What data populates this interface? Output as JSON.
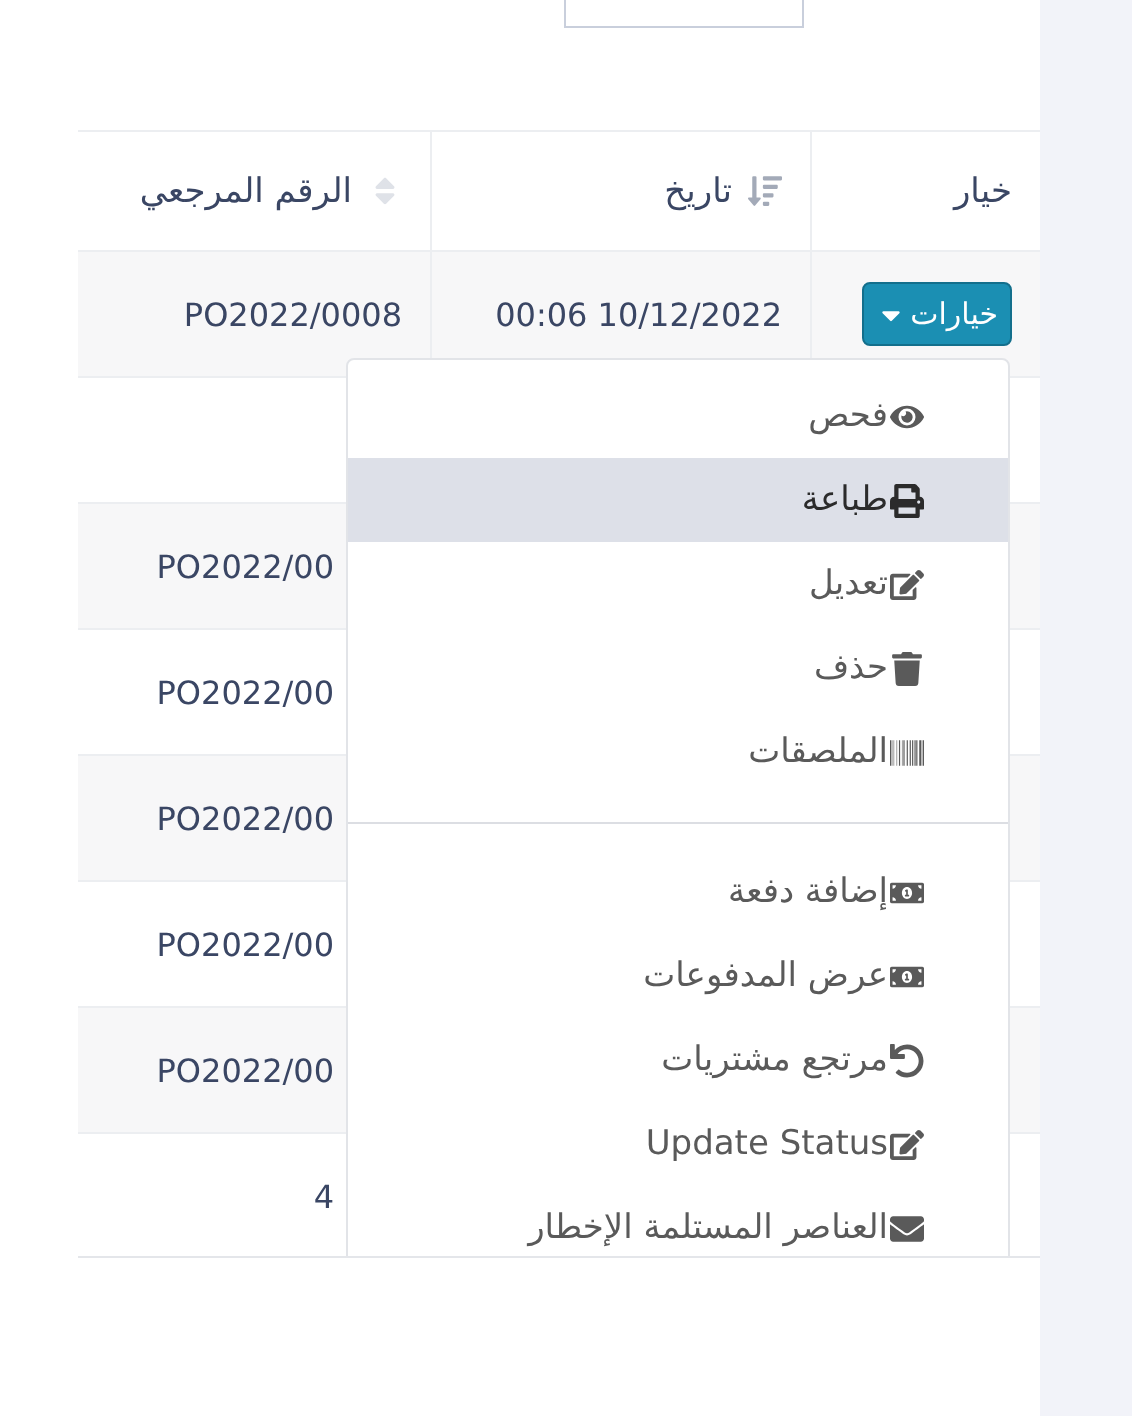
{
  "table": {
    "columns": [
      {
        "label": "خيار",
        "kind": "plain"
      },
      {
        "label": "تاريخ",
        "kind": "descending"
      },
      {
        "label": "الرقم المرجعي",
        "kind": "unsorted"
      }
    ],
    "rows": [
      {
        "option_button": "خيارات",
        "date": "00:06 10/12/2022",
        "reference": "PO2022/0008"
      },
      {},
      {
        "reference": "PO2022/00"
      },
      {
        "reference": "PO2022/00"
      },
      {
        "reference": "PO2022/00"
      },
      {
        "reference": "PO2022/00"
      },
      {
        "reference": "PO2022/00"
      },
      {
        "reference": "4"
      }
    ]
  },
  "menu": {
    "sections": [
      [
        {
          "kind": "eye",
          "label": "فحص",
          "highlighted": false
        },
        {
          "kind": "print",
          "label": "طباعة",
          "highlighted": true
        },
        {
          "kind": "edit",
          "label": "تعديل",
          "highlighted": false
        },
        {
          "kind": "trash",
          "label": "حذف",
          "highlighted": false
        },
        {
          "kind": "barcode",
          "label": "الملصقات",
          "highlighted": false
        }
      ],
      [
        {
          "kind": "money",
          "label": "إضافة دفعة",
          "highlighted": false
        },
        {
          "kind": "money",
          "label": "عرض المدفوعات",
          "highlighted": false
        },
        {
          "kind": "undo",
          "label": "مرتجع مشتريات",
          "highlighted": false
        },
        {
          "kind": "edit",
          "label": "Update Status",
          "highlighted": false
        },
        {
          "kind": "envelope",
          "label": "العناصر المستلمة الإخطار",
          "highlighted": false
        }
      ]
    ]
  }
}
